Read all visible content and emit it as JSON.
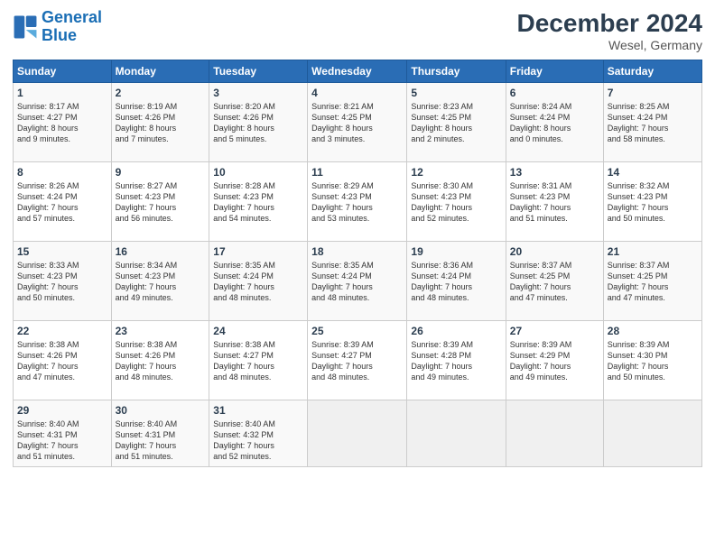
{
  "logo": {
    "line1": "General",
    "line2": "Blue"
  },
  "title": "December 2024",
  "subtitle": "Wesel, Germany",
  "days": [
    "Sunday",
    "Monday",
    "Tuesday",
    "Wednesday",
    "Thursday",
    "Friday",
    "Saturday"
  ],
  "weeks": [
    [
      {
        "num": "1",
        "sunrise": "8:17 AM",
        "sunset": "4:27 PM",
        "daylight": "8 hours and 9 minutes."
      },
      {
        "num": "2",
        "sunrise": "8:19 AM",
        "sunset": "4:26 PM",
        "daylight": "8 hours and 7 minutes."
      },
      {
        "num": "3",
        "sunrise": "8:20 AM",
        "sunset": "4:26 PM",
        "daylight": "8 hours and 5 minutes."
      },
      {
        "num": "4",
        "sunrise": "8:21 AM",
        "sunset": "4:25 PM",
        "daylight": "8 hours and 3 minutes."
      },
      {
        "num": "5",
        "sunrise": "8:23 AM",
        "sunset": "4:25 PM",
        "daylight": "8 hours and 2 minutes."
      },
      {
        "num": "6",
        "sunrise": "8:24 AM",
        "sunset": "4:24 PM",
        "daylight": "8 hours and 0 minutes."
      },
      {
        "num": "7",
        "sunrise": "8:25 AM",
        "sunset": "4:24 PM",
        "daylight": "7 hours and 58 minutes."
      }
    ],
    [
      {
        "num": "8",
        "sunrise": "8:26 AM",
        "sunset": "4:24 PM",
        "daylight": "7 hours and 57 minutes."
      },
      {
        "num": "9",
        "sunrise": "8:27 AM",
        "sunset": "4:23 PM",
        "daylight": "7 hours and 56 minutes."
      },
      {
        "num": "10",
        "sunrise": "8:28 AM",
        "sunset": "4:23 PM",
        "daylight": "7 hours and 54 minutes."
      },
      {
        "num": "11",
        "sunrise": "8:29 AM",
        "sunset": "4:23 PM",
        "daylight": "7 hours and 53 minutes."
      },
      {
        "num": "12",
        "sunrise": "8:30 AM",
        "sunset": "4:23 PM",
        "daylight": "7 hours and 52 minutes."
      },
      {
        "num": "13",
        "sunrise": "8:31 AM",
        "sunset": "4:23 PM",
        "daylight": "7 hours and 51 minutes."
      },
      {
        "num": "14",
        "sunrise": "8:32 AM",
        "sunset": "4:23 PM",
        "daylight": "7 hours and 50 minutes."
      }
    ],
    [
      {
        "num": "15",
        "sunrise": "8:33 AM",
        "sunset": "4:23 PM",
        "daylight": "7 hours and 50 minutes."
      },
      {
        "num": "16",
        "sunrise": "8:34 AM",
        "sunset": "4:23 PM",
        "daylight": "7 hours and 49 minutes."
      },
      {
        "num": "17",
        "sunrise": "8:35 AM",
        "sunset": "4:24 PM",
        "daylight": "7 hours and 48 minutes."
      },
      {
        "num": "18",
        "sunrise": "8:35 AM",
        "sunset": "4:24 PM",
        "daylight": "7 hours and 48 minutes."
      },
      {
        "num": "19",
        "sunrise": "8:36 AM",
        "sunset": "4:24 PM",
        "daylight": "7 hours and 48 minutes."
      },
      {
        "num": "20",
        "sunrise": "8:37 AM",
        "sunset": "4:25 PM",
        "daylight": "7 hours and 47 minutes."
      },
      {
        "num": "21",
        "sunrise": "8:37 AM",
        "sunset": "4:25 PM",
        "daylight": "7 hours and 47 minutes."
      }
    ],
    [
      {
        "num": "22",
        "sunrise": "8:38 AM",
        "sunset": "4:26 PM",
        "daylight": "7 hours and 47 minutes."
      },
      {
        "num": "23",
        "sunrise": "8:38 AM",
        "sunset": "4:26 PM",
        "daylight": "7 hours and 48 minutes."
      },
      {
        "num": "24",
        "sunrise": "8:38 AM",
        "sunset": "4:27 PM",
        "daylight": "7 hours and 48 minutes."
      },
      {
        "num": "25",
        "sunrise": "8:39 AM",
        "sunset": "4:27 PM",
        "daylight": "7 hours and 48 minutes."
      },
      {
        "num": "26",
        "sunrise": "8:39 AM",
        "sunset": "4:28 PM",
        "daylight": "7 hours and 49 minutes."
      },
      {
        "num": "27",
        "sunrise": "8:39 AM",
        "sunset": "4:29 PM",
        "daylight": "7 hours and 49 minutes."
      },
      {
        "num": "28",
        "sunrise": "8:39 AM",
        "sunset": "4:30 PM",
        "daylight": "7 hours and 50 minutes."
      }
    ],
    [
      {
        "num": "29",
        "sunrise": "8:40 AM",
        "sunset": "4:31 PM",
        "daylight": "7 hours and 51 minutes."
      },
      {
        "num": "30",
        "sunrise": "8:40 AM",
        "sunset": "4:31 PM",
        "daylight": "7 hours and 51 minutes."
      },
      {
        "num": "31",
        "sunrise": "8:40 AM",
        "sunset": "4:32 PM",
        "daylight": "7 hours and 52 minutes."
      },
      null,
      null,
      null,
      null
    ]
  ],
  "labels": {
    "sunrise": "Sunrise:",
    "sunset": "Sunset:",
    "daylight": "Daylight:"
  }
}
